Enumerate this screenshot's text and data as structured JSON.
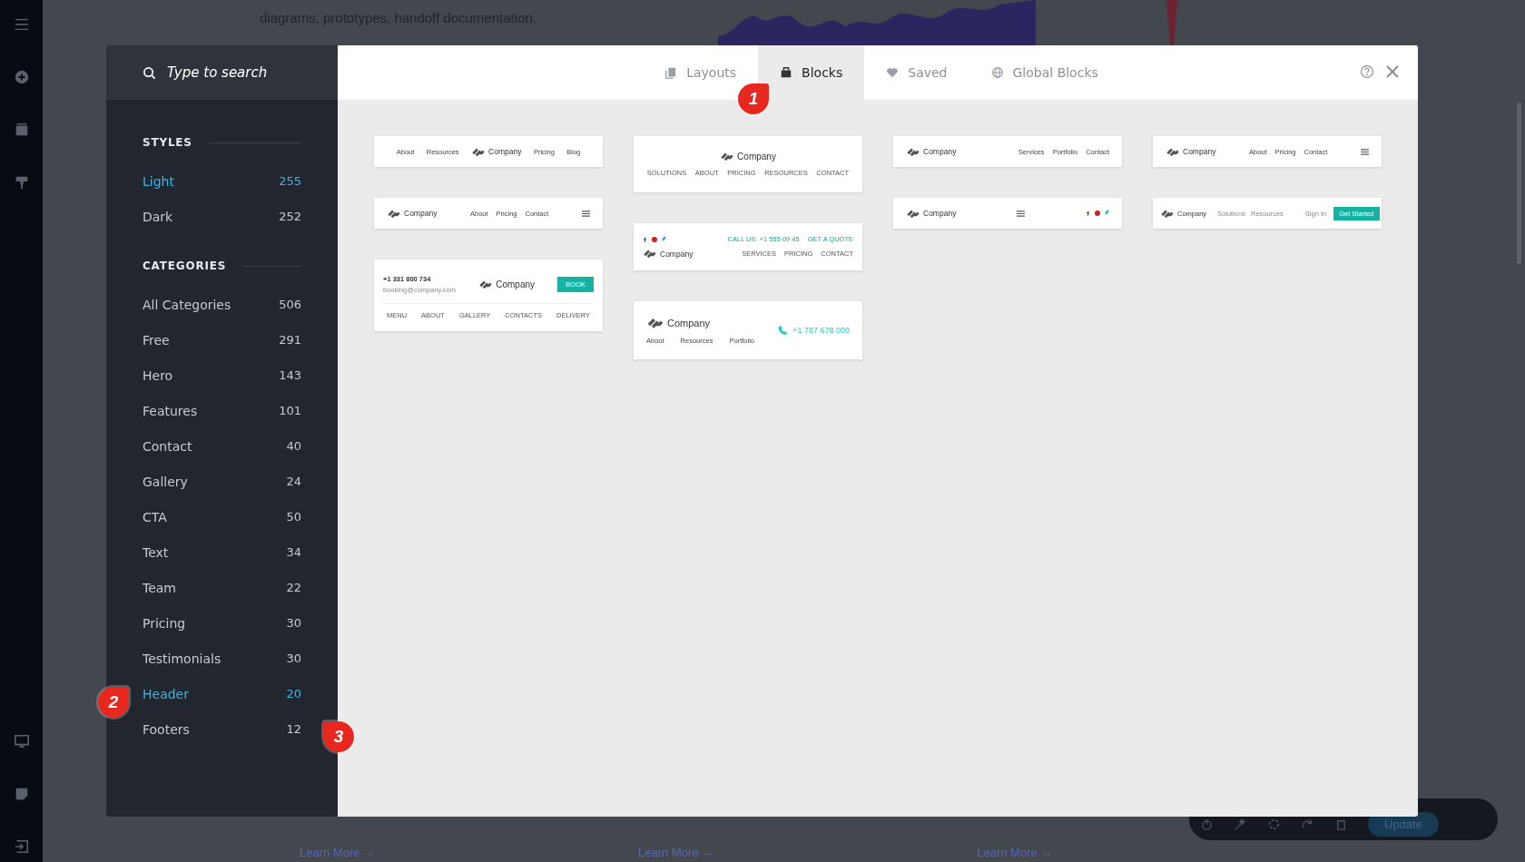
{
  "background": {
    "text": "diagrams, prototypes, handoff documentation.",
    "links": [
      "Learn More →",
      "Learn More →",
      "Learn More →"
    ]
  },
  "toolbar": {
    "button": "Update"
  },
  "modal": {
    "search": {
      "placeholder": "Type to search"
    },
    "tabs": [
      {
        "label": "Layouts",
        "kind": "layouts",
        "selected": false
      },
      {
        "label": "Blocks",
        "kind": "blocks",
        "selected": true
      },
      {
        "label": "Saved",
        "kind": "saved",
        "selected": false
      },
      {
        "label": "Global Blocks",
        "kind": "global",
        "selected": false
      }
    ],
    "styles": {
      "title": "STYLES",
      "items": [
        {
          "label": "Light",
          "count": "255",
          "selected": true
        },
        {
          "label": "Dark",
          "count": "252",
          "selected": false
        }
      ]
    },
    "categories": {
      "title": "CATEGORIES",
      "items": [
        {
          "label": "All Categories",
          "count": "506",
          "selected": false
        },
        {
          "label": "Free",
          "count": "291",
          "selected": false
        },
        {
          "label": "Hero",
          "count": "143",
          "selected": false
        },
        {
          "label": "Features",
          "count": "101",
          "selected": false
        },
        {
          "label": "Contact",
          "count": "40",
          "selected": false
        },
        {
          "label": "Gallery",
          "count": "24",
          "selected": false
        },
        {
          "label": "CTA",
          "count": "50",
          "selected": false
        },
        {
          "label": "Text",
          "count": "34",
          "selected": false
        },
        {
          "label": "Team",
          "count": "22",
          "selected": false
        },
        {
          "label": "Pricing",
          "count": "30",
          "selected": false
        },
        {
          "label": "Testimonials",
          "count": "30",
          "selected": false
        },
        {
          "label": "Header",
          "count": "20",
          "selected": true
        },
        {
          "label": "Footers",
          "count": "12",
          "selected": false
        }
      ]
    },
    "columns": [
      [
        {
          "kind": "centered",
          "logo": "Company",
          "left": [
            "About",
            "Resources"
          ],
          "right": [
            "Pricing",
            "Blog"
          ]
        },
        {
          "kind": "nav-menu",
          "logo": "Company",
          "nav": [
            "About",
            "Pricing",
            "Contact"
          ]
        },
        {
          "kind": "contact-book",
          "logo": "Company",
          "phone": "+1 331 800 734",
          "email": "booking@company.com",
          "button": "BOOK",
          "nav": [
            "MENU",
            "ABOUT",
            "GALLERY",
            "CONTACTS",
            "DELIVERY"
          ]
        }
      ],
      [
        {
          "kind": "stacked",
          "logo": "Company",
          "nav": [
            "SOLUTIONS",
            "ABOUT",
            "PRICING",
            "RESOURCES",
            "CONTACT"
          ]
        },
        {
          "kind": "topbar",
          "logo": "Company",
          "top": [
            "CALL US: +1 555 09 45",
            "GET A QUOTE"
          ],
          "nav": [
            "SERVICES",
            "PRICING",
            "CONTACT"
          ]
        },
        {
          "kind": "phone",
          "logo": "Company",
          "nav": [
            "About",
            "Resources",
            "Portfolio"
          ],
          "phone": "+1 787 678 000"
        }
      ],
      [
        {
          "kind": "nav",
          "logo": "Company",
          "nav": [
            "Services",
            "Portfolio",
            "Contact"
          ]
        },
        {
          "kind": "menu-social",
          "logo": "Company"
        }
      ],
      [
        {
          "kind": "nav-menu",
          "logo": "Company",
          "nav": [
            "About",
            "Pricing",
            "Contact"
          ]
        },
        {
          "kind": "signup",
          "logo": "Company",
          "nav": [
            "Solutions",
            "Resources"
          ],
          "signin": "Sign In",
          "button": "Get Started"
        }
      ]
    ]
  },
  "callouts": [
    "1",
    "2",
    "3"
  ]
}
